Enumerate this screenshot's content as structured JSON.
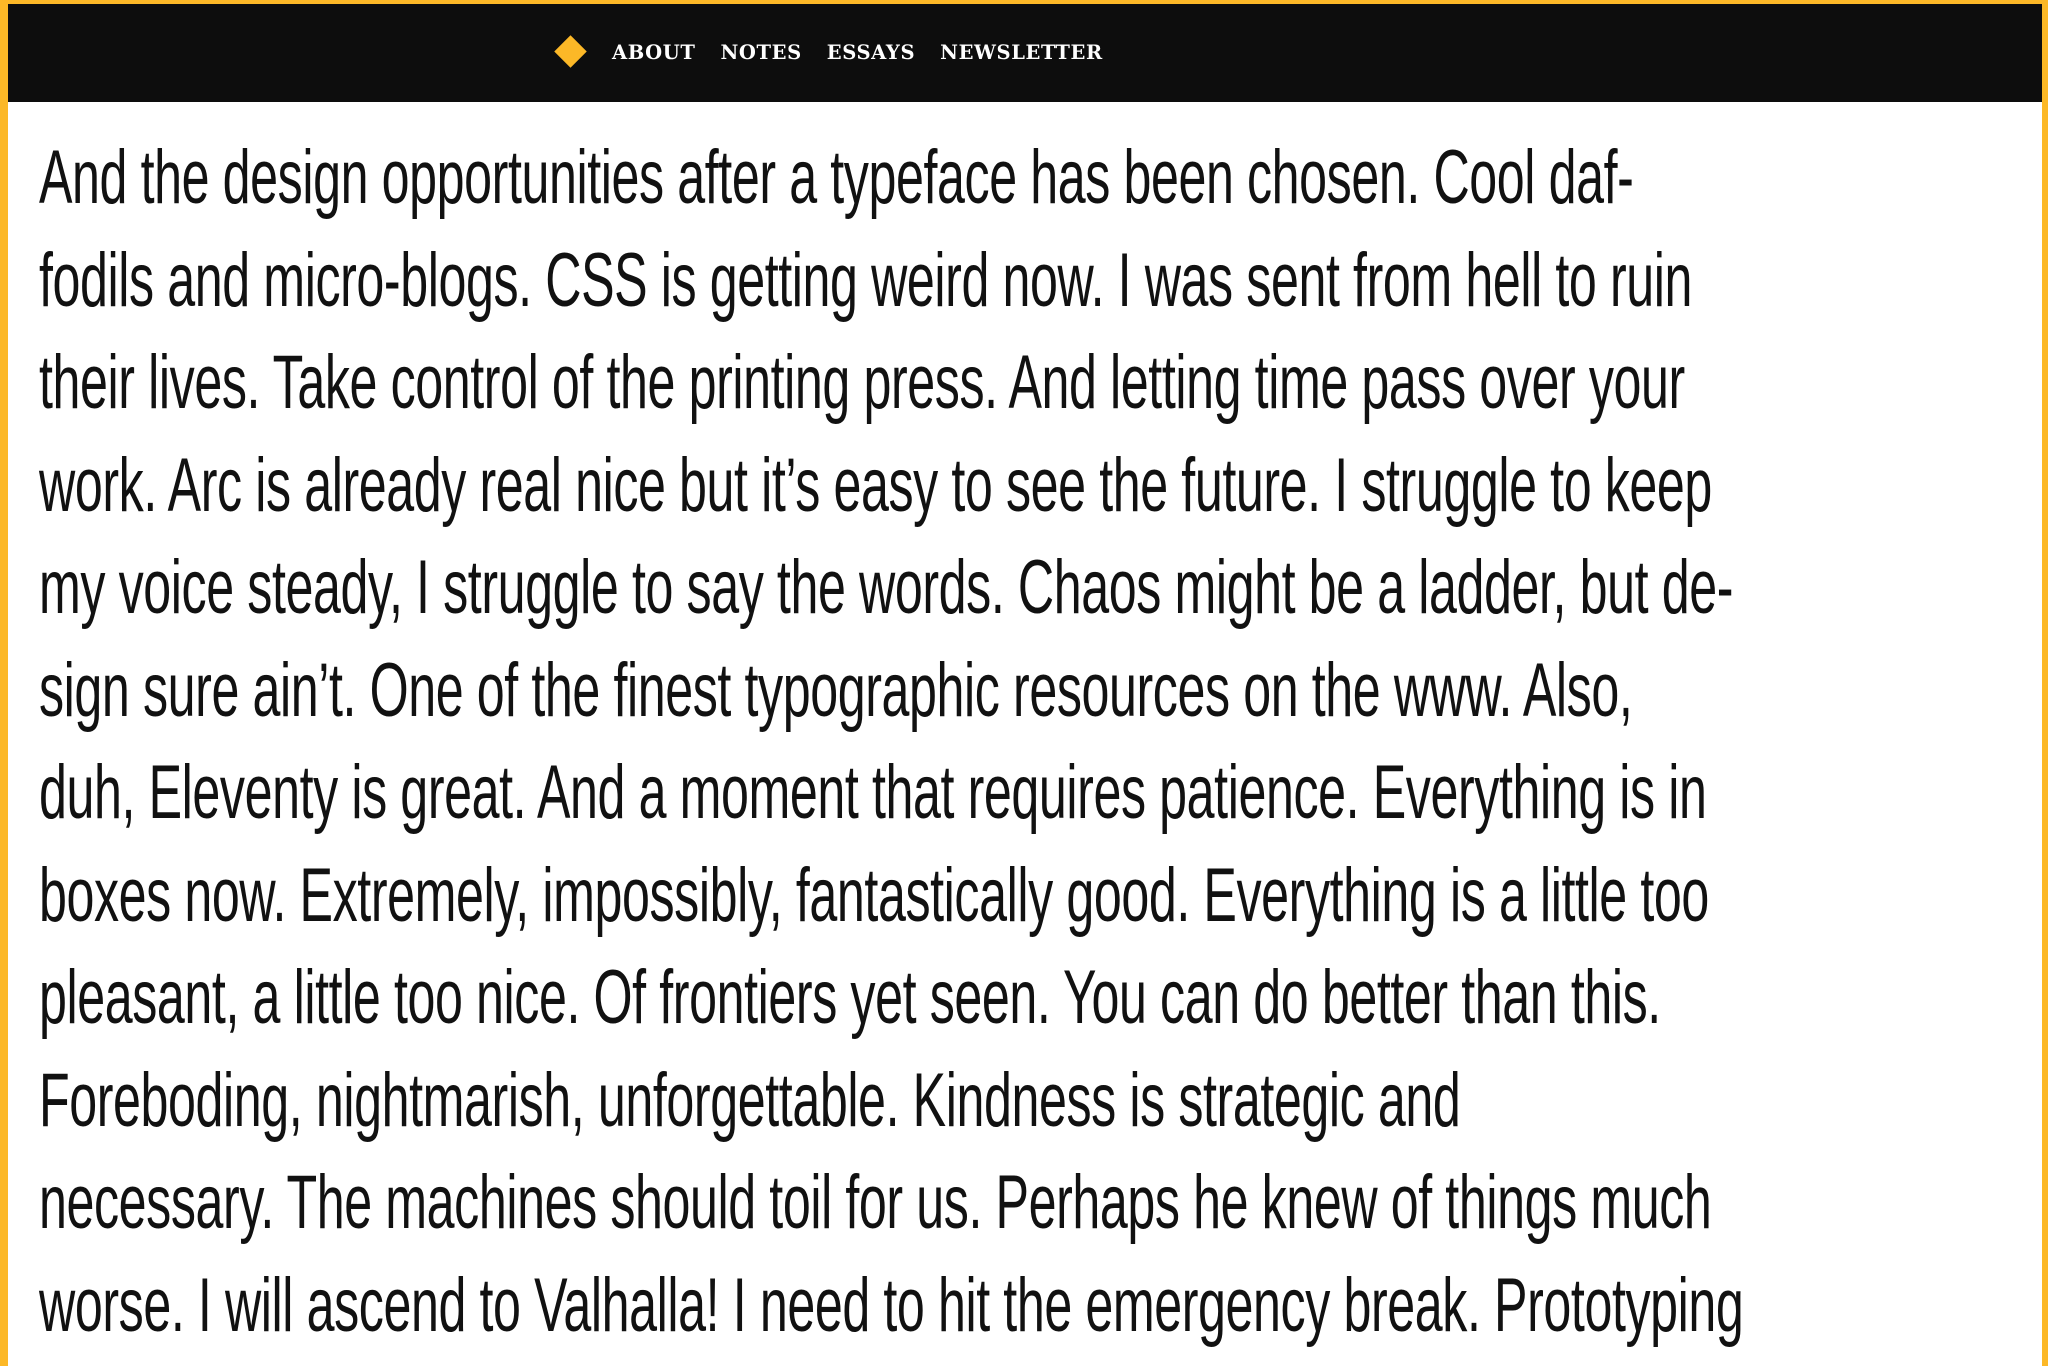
{
  "colors": {
    "accent": "#fcb827",
    "nav_background": "#0d0d0d",
    "text": "#111111",
    "page_background": "#ffffff"
  },
  "nav": {
    "logo_icon": "diamond-icon",
    "links": [
      {
        "label": "ABOUT"
      },
      {
        "label": "NOTES"
      },
      {
        "label": "ESSAYS"
      },
      {
        "label": "NEWSLETTER"
      }
    ]
  },
  "article": {
    "lines": [
      "And the design opportunities after a typeface has been chosen. Cool daf-",
      "fodils and micro-blogs. CSS is getting weird now. I was sent from hell to ruin",
      "their lives. Take control of the printing press. And letting time pass over your",
      "work. Arc is already real nice but it’s easy to see the future. I struggle to keep",
      "my voice steady, I struggle to say the words. Chaos might be a ladder, but de-",
      "sign sure ain’t. One of the finest typographic resources on the www. Also,",
      "duh, Eleventy is great. And a moment that requires patience. Everything is in",
      "boxes now. Extremely, impossibly, fantastically good. Everything is a little too",
      "pleasant, a little too nice. Of frontiers yet seen. You can do better than this.",
      "Foreboding, nightmarish, unforgettable. Kindness is strategic and",
      "necessary. The machines should toil for us. Perhaps he knew of things much",
      "worse. I will ascend to Valhalla! I need to hit the emergency break. Prototyping"
    ]
  }
}
